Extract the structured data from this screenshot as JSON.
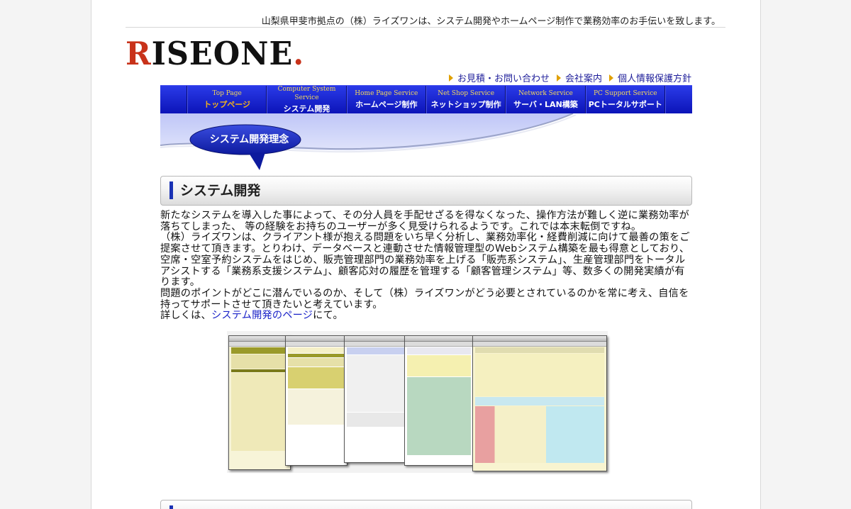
{
  "header": {
    "tagline": "山梨県甲斐市拠点の（株）ライズワンは、システム開発やホームページ制作で業務効率のお手伝いを致します。",
    "logo": {
      "first": "R",
      "rest": "ISEONE",
      "dot": "."
    }
  },
  "utility_links": [
    {
      "label": "お見積・お問い合わせ"
    },
    {
      "label": "会社案内"
    },
    {
      "label": "個人情報保護方針"
    }
  ],
  "nav": [
    {
      "en": "Top Page",
      "jp": "トップページ"
    },
    {
      "en": "Computer System Service",
      "jp": "システム開発"
    },
    {
      "en": "Home Page Service",
      "jp": "ホームページ制作"
    },
    {
      "en": "Net Shop Service",
      "jp": "ネットショップ制作"
    },
    {
      "en": "Network Service",
      "jp": "サーバ・LAN構築"
    },
    {
      "en": "PC Support Service",
      "jp": "PCトータルサポート"
    }
  ],
  "banner": {
    "label": "システム開発理念"
  },
  "section": {
    "title": "システム開発",
    "paragraph1": "新たなシステムを導入した事によって、その分人員を手配せざるを得なくなった、操作方法が難しく逆に業務効率が落ちてしまった、 等の経験をお持ちのユーザーが多く見受けられるようです。これでは本末転倒ですね。",
    "paragraph2": "（株）ライズワンは、クライアント様が抱える問題をいち早く分析し、業務効率化・経費削減に向けて最善の策をご提案させて頂きます。とりわけ、データベースと連動させた情報管理型のWebシステム構築を最も得意としており、空席・空室予約システムをはじめ、販売管理部門の業務効率を上げる「販売系システム」、生産管理部門をトータルアシストする「業務系支援システム」、顧客応対の履歴を管理する「顧客管理システム」等、数多くの開発実績が有ります。",
    "paragraph3": "問題のポイントがどこに潜んでいるのか、そして（株）ライズワンがどう必要とされているのかを常に考え、自信を持ってサポートさせて頂きたいと考えています。",
    "detail_prefix": "詳しくは、",
    "detail_link": "システム開発のページ",
    "detail_suffix": "にて。"
  },
  "colors": {
    "nav": "#1a24d0",
    "logo_red": "#c8321a",
    "link": "#1b23c8",
    "accent_bar": "#1a32b4"
  }
}
